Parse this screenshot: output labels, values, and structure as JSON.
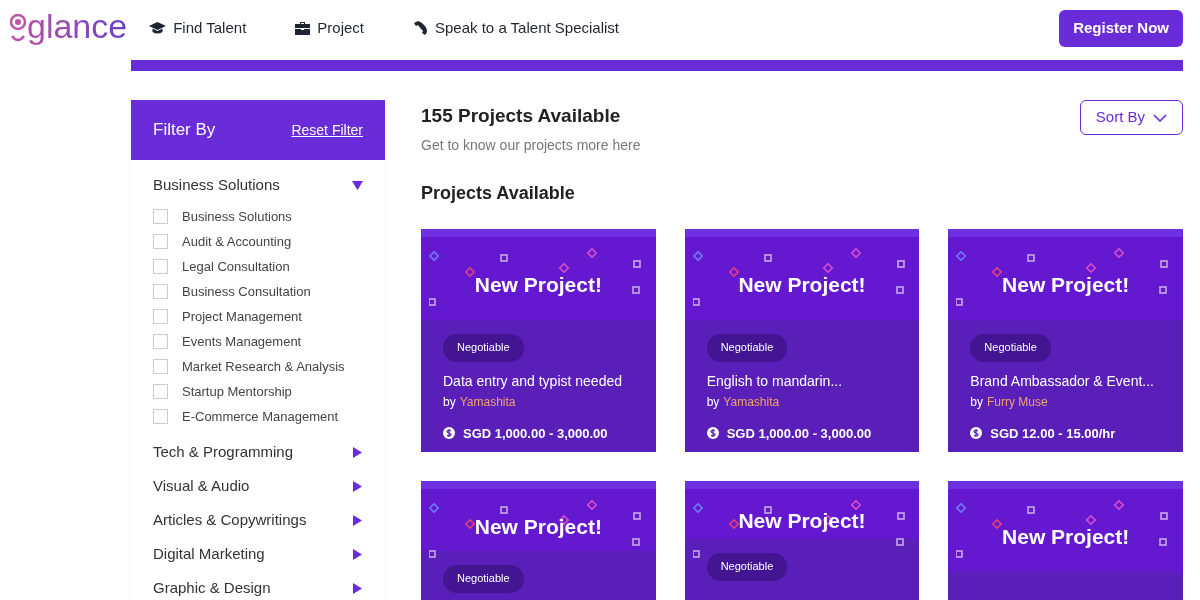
{
  "logo": "glance",
  "nav": [
    {
      "kind": "cap",
      "label": "Find Talent"
    },
    {
      "kind": "briefcase",
      "label": "Project"
    },
    {
      "kind": "phone",
      "label": "Speak to a Talent Specialist"
    }
  ],
  "register_button": "Register Now",
  "filter": {
    "title": "Filter By",
    "reset": "Reset Filter",
    "groups": [
      {
        "label": "Business Solutions",
        "expanded": true,
        "children": [
          {
            "label": "Business Solutions",
            "checked": false
          },
          {
            "label": "Audit & Accounting",
            "checked": false
          },
          {
            "label": "Legal Consultation",
            "checked": false
          },
          {
            "label": "Business Consultation",
            "checked": false
          },
          {
            "label": "Project Management",
            "checked": false
          },
          {
            "label": "Events Management",
            "checked": false
          },
          {
            "label": "Market Research & Analysis",
            "checked": false
          },
          {
            "label": "Startup Mentorship",
            "checked": false
          },
          {
            "label": "E-Commerce Management",
            "checked": false
          }
        ]
      },
      {
        "label": "Tech & Programming",
        "expanded": false
      },
      {
        "label": "Visual & Audio",
        "expanded": false
      },
      {
        "label": "Articles & Copywritings",
        "expanded": false
      },
      {
        "label": "Digital Marketing",
        "expanded": false
      },
      {
        "label": "Graphic & Design",
        "expanded": false
      }
    ]
  },
  "heading": "155 Projects Available",
  "subheading": "Get to know our projects more here",
  "sort_button": "Sort By",
  "section_title": "Projects Available",
  "projects": [
    {
      "banner": "New Project!",
      "badge": "Negotiable",
      "title": "Data entry and typist needed",
      "by": "by",
      "author": "Yamashita",
      "price": "SGD 1,000.00 - 3,000.00"
    },
    {
      "banner": "New Project!",
      "badge": "Negotiable",
      "title": "English to mandarin...",
      "by": "by",
      "author": "Yamashita",
      "price": "SGD 1,000.00 - 3,000.00"
    },
    {
      "banner": "New Project!",
      "badge": "Negotiable",
      "title": "Brand Ambassador & Event...",
      "by": "by",
      "author": "Furry Muse",
      "price": "SGD 12.00 - 15.00/hr"
    },
    {
      "banner": "New Project!",
      "badge": "Negotiable"
    },
    {
      "banner": "New Project!",
      "badge": "Negotiable"
    },
    {
      "banner": "New Project!"
    }
  ]
}
